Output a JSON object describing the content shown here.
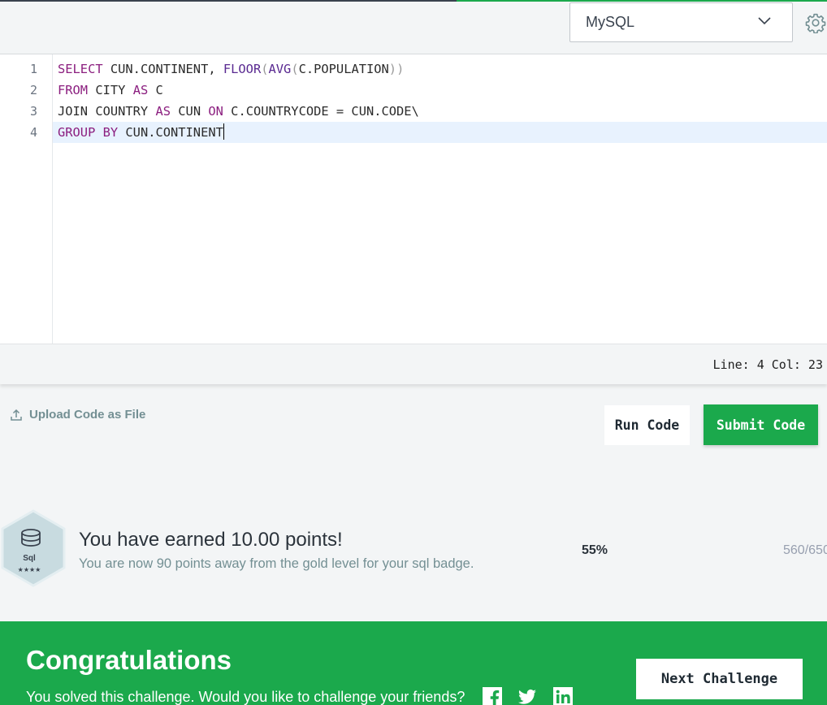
{
  "toolbar": {
    "language": "MySQL",
    "chevron_icon": "chevron-down-icon",
    "settings_icon": "gear-icon"
  },
  "editor": {
    "line_numbers": [
      "1",
      "2",
      "3",
      "4"
    ],
    "lines": [
      {
        "tokens": [
          [
            "kw",
            "SELECT"
          ],
          [
            "txt",
            " CUN.CONTINENT, "
          ],
          [
            "fn",
            "FLOOR"
          ],
          [
            "par",
            "("
          ],
          [
            "fn",
            "AVG"
          ],
          [
            "par",
            "("
          ],
          [
            "txt",
            "C.POPULATION"
          ],
          [
            "par",
            "))"
          ]
        ]
      },
      {
        "tokens": [
          [
            "kw",
            "FROM"
          ],
          [
            "txt",
            " CITY "
          ],
          [
            "kw",
            "AS"
          ],
          [
            "txt",
            " C"
          ]
        ]
      },
      {
        "tokens": [
          [
            "txt",
            "JOIN COUNTRY "
          ],
          [
            "kw",
            "AS"
          ],
          [
            "txt",
            " CUN "
          ],
          [
            "kw",
            "ON"
          ],
          [
            "txt",
            " C.COUNTRYCODE = CUN.CODE\\"
          ]
        ]
      },
      {
        "tokens": [
          [
            "kw",
            "GROUP BY"
          ],
          [
            "txt",
            " CUN.CONTINENT"
          ]
        ]
      }
    ]
  },
  "status": {
    "cursor_position": "Line: 4 Col: 23"
  },
  "actions": {
    "upload_label": "Upload Code as File",
    "run_label": "Run Code",
    "submit_label": "Submit Code"
  },
  "points": {
    "badge_name": "Sql",
    "badge_stars": "★★★★",
    "earned_text": "You have earned 10.00 points!",
    "away_text": "You are now 90 points away from the gold level for your sql badge.",
    "percent": "55%",
    "score": "560/650"
  },
  "congrats": {
    "title": "Congratulations",
    "message": "You solved this challenge. Would you like to challenge your friends?",
    "next_label": "Next Challenge"
  },
  "colors": {
    "accent_green": "#1ba94c",
    "keyword": "#8b1e7f",
    "function": "#5a2a91",
    "active_line": "#e8f2fe"
  }
}
